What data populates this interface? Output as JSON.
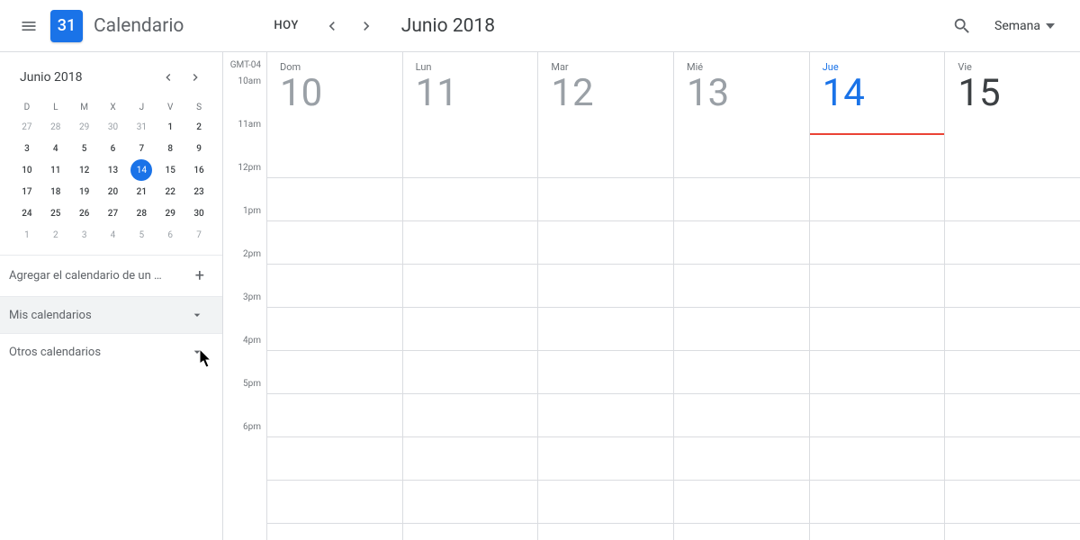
{
  "header": {
    "logo_day": "31",
    "app_title": "Calendario",
    "today_label": "HOY",
    "month_title": "Junio 2018",
    "view_label": "Semana"
  },
  "sidebar": {
    "mini_month": "Junio 2018",
    "dow": [
      "D",
      "L",
      "M",
      "X",
      "J",
      "V",
      "S"
    ],
    "weeks": [
      [
        {
          "d": "27",
          "m": true
        },
        {
          "d": "28",
          "m": true
        },
        {
          "d": "29",
          "m": true
        },
        {
          "d": "30",
          "m": true
        },
        {
          "d": "31",
          "m": true
        },
        {
          "d": "1",
          "b": true
        },
        {
          "d": "2",
          "b": true
        }
      ],
      [
        {
          "d": "3",
          "b": true
        },
        {
          "d": "4",
          "b": true
        },
        {
          "d": "5",
          "b": true
        },
        {
          "d": "6",
          "b": true
        },
        {
          "d": "7",
          "b": true
        },
        {
          "d": "8",
          "b": true
        },
        {
          "d": "9",
          "b": true
        }
      ],
      [
        {
          "d": "10",
          "b": true
        },
        {
          "d": "11",
          "b": true
        },
        {
          "d": "12",
          "b": true
        },
        {
          "d": "13",
          "b": true
        },
        {
          "d": "14",
          "t": true
        },
        {
          "d": "15",
          "b": true
        },
        {
          "d": "16",
          "b": true
        }
      ],
      [
        {
          "d": "17",
          "b": true
        },
        {
          "d": "18",
          "b": true
        },
        {
          "d": "19",
          "b": true
        },
        {
          "d": "20",
          "b": true
        },
        {
          "d": "21",
          "b": true
        },
        {
          "d": "22",
          "b": true
        },
        {
          "d": "23",
          "b": true
        }
      ],
      [
        {
          "d": "24",
          "b": true
        },
        {
          "d": "25",
          "b": true
        },
        {
          "d": "26",
          "b": true
        },
        {
          "d": "27",
          "b": true
        },
        {
          "d": "28",
          "b": true
        },
        {
          "d": "29",
          "b": true
        },
        {
          "d": "30",
          "b": true
        }
      ],
      [
        {
          "d": "1",
          "m": true
        },
        {
          "d": "2",
          "m": true
        },
        {
          "d": "3",
          "m": true
        },
        {
          "d": "4",
          "m": true
        },
        {
          "d": "5",
          "m": true
        },
        {
          "d": "6",
          "m": true
        },
        {
          "d": "7",
          "m": true
        }
      ]
    ],
    "add_friend_label": "Agregar el calendario de un …",
    "my_calendars_label": "Mis calendarios",
    "other_calendars_label": "Otros calendarios"
  },
  "week": {
    "tz": "GMT-04",
    "times": [
      "10am",
      "11am",
      "12pm",
      "1pm",
      "2pm",
      "3pm",
      "4pm",
      "5pm",
      "6pm"
    ],
    "days": [
      {
        "dow": "Dom",
        "num": "10"
      },
      {
        "dow": "Lun",
        "num": "11"
      },
      {
        "dow": "Mar",
        "num": "12"
      },
      {
        "dow": "Mié",
        "num": "13"
      },
      {
        "dow": "Jue",
        "num": "14",
        "today": true
      },
      {
        "dow": "Vie",
        "num": "15",
        "black": true
      }
    ]
  }
}
